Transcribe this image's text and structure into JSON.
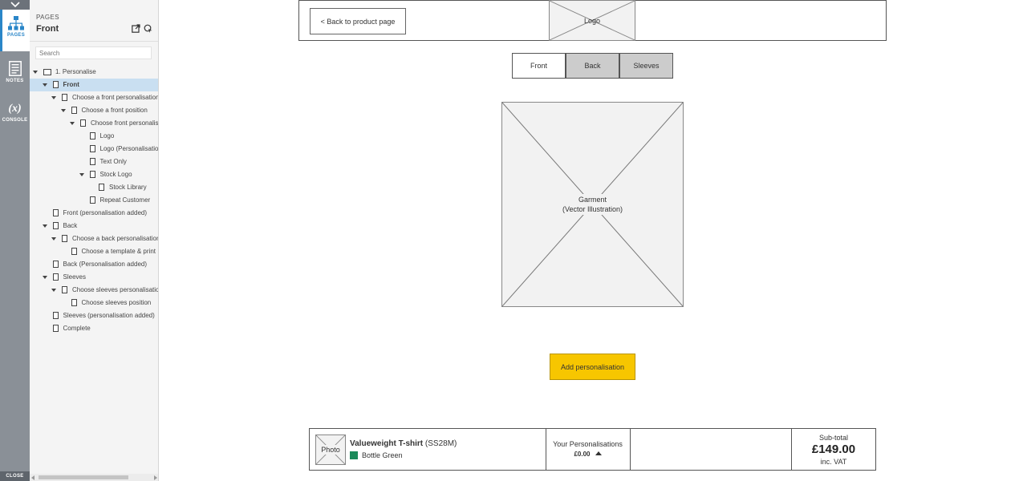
{
  "iconbar": {
    "tabs": [
      {
        "label": "PAGES",
        "icon": "sitemap-icon",
        "active": true
      },
      {
        "label": "NOTES",
        "icon": "notes-icon",
        "active": false
      },
      {
        "label": "CONSOLE",
        "icon": "variable-x-icon",
        "active": false
      }
    ],
    "console_glyph": "(x)",
    "close_label": "CLOSE"
  },
  "sidebar": {
    "section_label": "PAGES",
    "current_page": "Front",
    "search_placeholder": "Search",
    "tree": [
      {
        "label": "1. Personalise",
        "level": 0,
        "type": "folder",
        "expanded": true,
        "selected": false
      },
      {
        "label": "Front",
        "level": 1,
        "type": "page",
        "expanded": true,
        "selected": true
      },
      {
        "label": "Choose a front personalisation",
        "level": 2,
        "type": "page",
        "expanded": true,
        "selected": false
      },
      {
        "label": "Choose a front position",
        "level": 3,
        "type": "page",
        "expanded": true,
        "selected": false
      },
      {
        "label": "Choose front personalisation",
        "level": 4,
        "type": "page",
        "expanded": true,
        "selected": false
      },
      {
        "label": "Logo",
        "level": 5,
        "type": "page",
        "expanded": false,
        "selected": false
      },
      {
        "label": "Logo (Personalisation)",
        "level": 5,
        "type": "page",
        "expanded": false,
        "selected": false
      },
      {
        "label": "Text Only",
        "level": 5,
        "type": "page",
        "expanded": false,
        "selected": false
      },
      {
        "label": "Stock Logo",
        "level": 5,
        "type": "page",
        "expanded": true,
        "selected": false,
        "toggle": true
      },
      {
        "label": "Stock Library",
        "level": 6,
        "type": "page",
        "expanded": false,
        "selected": false
      },
      {
        "label": "Repeat Customer",
        "level": 5,
        "type": "page",
        "expanded": false,
        "selected": false
      },
      {
        "label": "Front (personalisation added)",
        "level": 1,
        "type": "page",
        "expanded": false,
        "selected": false
      },
      {
        "label": "Back",
        "level": 1,
        "type": "page",
        "expanded": true,
        "selected": false,
        "toggle": true
      },
      {
        "label": "Choose a back personalisation",
        "level": 2,
        "type": "page",
        "expanded": true,
        "selected": false,
        "toggle": true
      },
      {
        "label": "Choose a template & print",
        "level": 3,
        "type": "page",
        "expanded": false,
        "selected": false
      },
      {
        "label": "Back (Personalisation added)",
        "level": 1,
        "type": "page",
        "expanded": false,
        "selected": false
      },
      {
        "label": "Sleeves",
        "level": 1,
        "type": "page",
        "expanded": true,
        "selected": false,
        "toggle": true
      },
      {
        "label": "Choose sleeves personalisation",
        "level": 2,
        "type": "page",
        "expanded": true,
        "selected": false,
        "toggle": true
      },
      {
        "label": "Choose sleeves position",
        "level": 3,
        "type": "page",
        "expanded": false,
        "selected": false
      },
      {
        "label": "Sleeves (personalisation added)",
        "level": 1,
        "type": "page",
        "expanded": false,
        "selected": false
      },
      {
        "label": "Complete",
        "level": 1,
        "type": "page",
        "expanded": false,
        "selected": false
      }
    ]
  },
  "header": {
    "back_label": "< Back to product page",
    "logo_label": "Logo"
  },
  "view_tabs": [
    {
      "label": "Front",
      "active": true
    },
    {
      "label": "Back",
      "active": false
    },
    {
      "label": "Sleeves",
      "active": false
    }
  ],
  "garment": {
    "line1": "Garment",
    "line2": "(Vector Illustration)"
  },
  "add_button_label": "Add personalisation",
  "footer": {
    "photo_label": "Photo",
    "product_name": "Valueweight T-shirt",
    "product_code": "(SS28M)",
    "colour_name": "Bottle Green",
    "colour_hex": "#1a8a5a",
    "personalisations_label": "Your Personalisations",
    "personalisations_value": "£0.00",
    "subtotal_label": "Sub-total",
    "subtotal_value": "£149.00",
    "vat_label": "inc. VAT"
  },
  "colors": {
    "accent": "#2a86c8",
    "selected_row": "#c9dff1",
    "cta": "#f7c600"
  }
}
